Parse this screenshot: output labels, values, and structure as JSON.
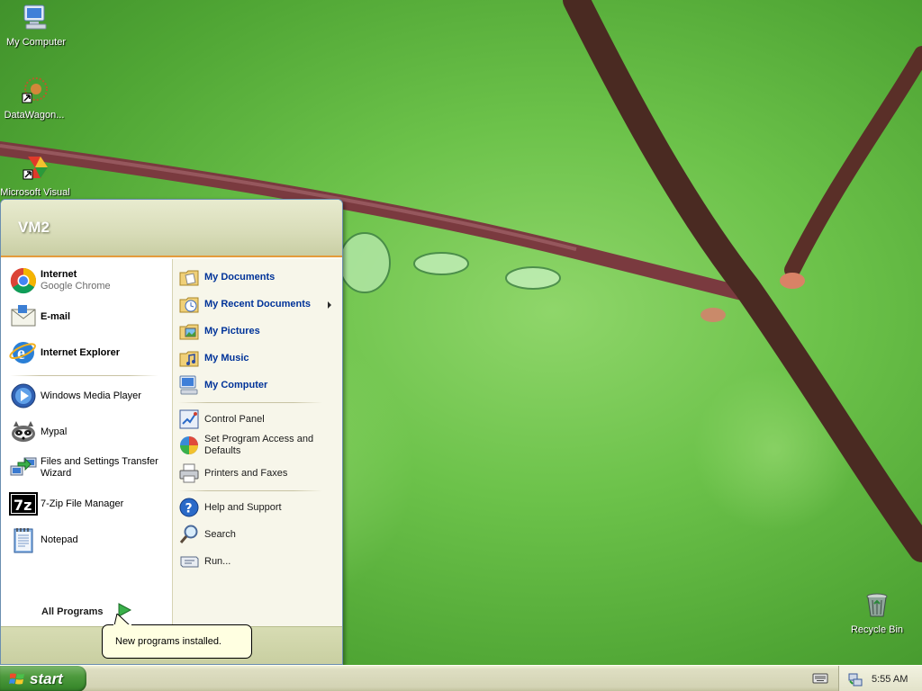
{
  "desktop": {
    "icons": [
      {
        "label": "My Computer",
        "icon": "my-computer-icon"
      },
      {
        "label": "DataWagon...",
        "icon": "datawagon-icon"
      },
      {
        "label": "Microsoft Visual",
        "icon": "visual-studio-icon"
      },
      {
        "label": "Recycle Bin",
        "icon": "recycle-bin-icon"
      }
    ]
  },
  "start_menu": {
    "user": "VM2",
    "pinned": [
      {
        "title": "Internet",
        "subtitle": "Google Chrome",
        "icon": "chrome-icon"
      },
      {
        "title": "E-mail",
        "icon": "email-icon"
      },
      {
        "title": "Internet Explorer",
        "icon": "internet-explorer-icon"
      }
    ],
    "recent": [
      {
        "label": "Windows Media Player",
        "icon": "media-player-icon"
      },
      {
        "label": "Mypal",
        "icon": "mypal-icon"
      },
      {
        "label": "Files and Settings Transfer Wizard",
        "line1": "Files and Settings Transfer",
        "line2": "Wizard",
        "icon": "transfer-wizard-icon"
      },
      {
        "label": "7-Zip File Manager",
        "icon": "7zip-icon"
      },
      {
        "label": "Notepad",
        "icon": "notepad-icon"
      }
    ],
    "all_programs": "All Programs",
    "places": [
      {
        "label": "My Documents",
        "icon": "folder-documents-icon"
      },
      {
        "label": "My Recent Documents",
        "icon": "recent-documents-icon"
      },
      {
        "label": "My Pictures",
        "icon": "folder-pictures-icon"
      },
      {
        "label": "My Music",
        "icon": "folder-music-icon"
      },
      {
        "label": "My Computer",
        "icon": "computer-icon"
      }
    ],
    "settings": [
      {
        "label": "Control Panel",
        "icon": "control-panel-icon"
      },
      {
        "label": "Set Program Access and Defaults",
        "line1": "Set Program Access and",
        "line2": "Defaults",
        "icon": "program-access-icon"
      },
      {
        "label": "Printers and Faxes",
        "icon": "printer-icon"
      }
    ],
    "tools": [
      {
        "label": "Help and Support",
        "icon": "help-icon"
      },
      {
        "label": "Search",
        "icon": "search-icon"
      },
      {
        "label": "Run...",
        "icon": "run-icon"
      }
    ]
  },
  "notification": {
    "text": "New programs installed."
  },
  "taskbar": {
    "start_label": "start",
    "clock": "5:55 AM"
  },
  "colors": {
    "menu_header": "#d8dcb8",
    "menu_accent": "#e49b3c",
    "places_text": "#003399",
    "start_button": "#3a8a2d"
  }
}
